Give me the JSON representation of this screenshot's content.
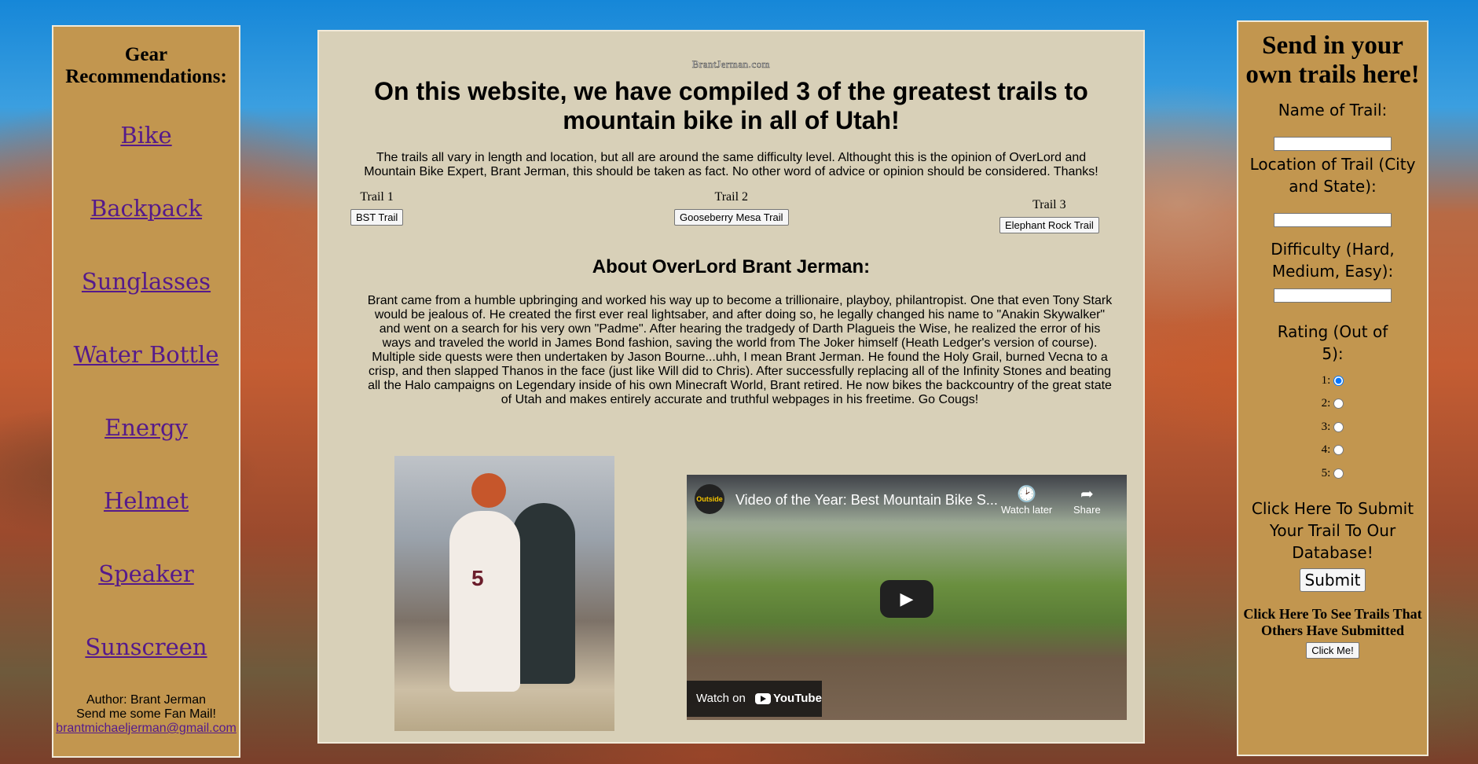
{
  "sidebar": {
    "title": "Gear Recommendations:",
    "links": [
      "Bike",
      "Backpack",
      "Sunglasses",
      "Water Bottle",
      "Energy",
      "Helmet",
      "Speaker",
      "Sunscreen"
    ],
    "author": "Author: Brant Jerman",
    "fan_mail": "Send me some Fan Mail!",
    "email": "brantmichaeljerman@gmail.com"
  },
  "main": {
    "site_name": "BrantJerman.com",
    "headline": "On this website, we have compiled 3 of the greatest trails to mountain bike in all of Utah!",
    "intro": "The trails all vary in length and location, but all are around the same difficulty level. Althought this is the opinion of OverLord and Mountain Bike Expert, Brant Jerman, this should be taken as fact. No other word of advice or opinion should be considered. Thanks!",
    "trails": [
      {
        "label": "Trail 1",
        "button": "BST Trail"
      },
      {
        "label": "Trail 2",
        "button": "Gooseberry Mesa Trail"
      },
      {
        "label": "Trail 3",
        "button": "Elephant Rock Trail"
      }
    ],
    "about_title": "About OverLord Brant Jerman:",
    "about_text": "Brant came from a humble upbringing and worked his way up to become a trillionaire, playboy, philantropist. One that even Tony Stark would be jealous of. He created the first ever real lightsaber, and after doing so, he legally changed his name to \"Anakin Skywalker\" and went on a search for his very own \"Padme\". After hearing the tradgedy of Darth Plagueis the Wise, he realized the error of his ways and traveled the world in James Bond fashion, saving the world from The Joker himself (Heath Ledger's version of course). Multiple side quests were then undertaken by Jason Bourne...uhh, I mean Brant Jerman. He found the Holy Grail, burned Vecna to a crisp, and then slapped Thanos in the face (just like Will did to Chris). After successfully replacing all of the Infinity Stones and beating all the Halo campaigns on Legendary inside of his own Minecraft World, Brant retired. He now bikes the backcountry of the great state of Utah and makes entirely accurate and truthful webpages in his freetime. Go Cougs!",
    "photo": {
      "jersey_text": "5"
    },
    "video": {
      "channel": "Outside",
      "title": "Video of the Year: Best Mountain Bike S...",
      "watch_later": "Watch later",
      "share": "Share",
      "watch_on": "Watch on",
      "youtube": "YouTube"
    }
  },
  "form": {
    "title": "Send in your own trails here!",
    "name_label": "Name of Trail:",
    "location_label": "Location of Trail (City and State):",
    "difficulty_label": "Difficulty (Hard, Medium, Easy):",
    "rating_label": "Rating (Out of 5):",
    "ratings": [
      "1:",
      "2:",
      "3:",
      "4:",
      "5:"
    ],
    "selected_rating": "1",
    "submit_prompt": "Click Here To Submit Your Trail To Our Database!",
    "submit_button": "Submit",
    "others_prompt": "Click Here To See Trails That Others Have Submitted",
    "click_me": "Click Me!"
  }
}
